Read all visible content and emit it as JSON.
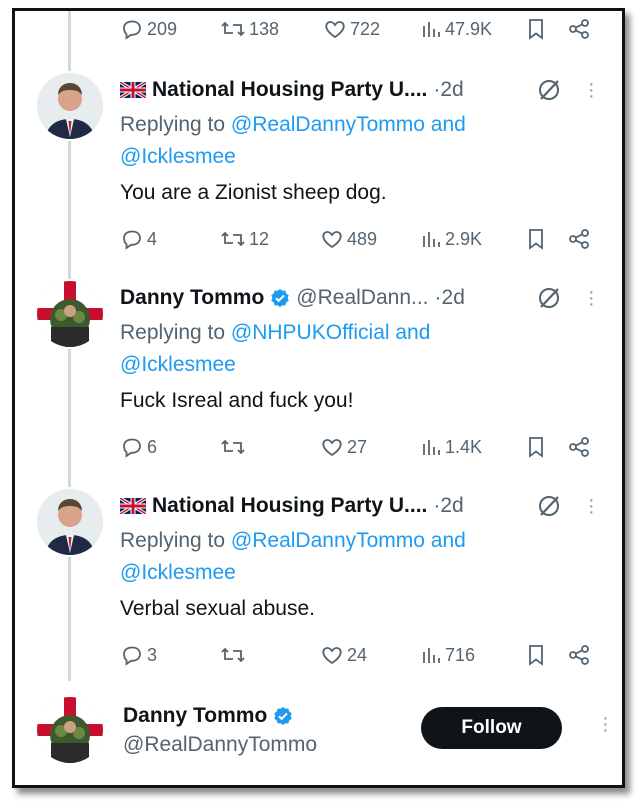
{
  "top_actions": {
    "replies": "209",
    "reposts": "138",
    "likes": "722",
    "views": "47.9K"
  },
  "tweets": [
    {
      "flag": "🇬🇧",
      "name": "National Housing Party U....",
      "handle": "",
      "dot": "·",
      "time": "2d",
      "reply_prefix": "Replying to ",
      "reply_mention_1": "@RealDannyTommo",
      "reply_and": " and",
      "reply_mention_2": "@Icklesmee",
      "text": "You are a Zionist sheep dog.",
      "replies": "4",
      "reposts": "12",
      "likes": "489",
      "views": "2.9K"
    },
    {
      "flag": "",
      "name": "Danny Tommo",
      "handle": "@RealDann...",
      "dot": "·",
      "time": "2d",
      "reply_prefix": "Replying to ",
      "reply_mention_1": "@NHPUKOfficial",
      "reply_and": " and",
      "reply_mention_2": "@Icklesmee",
      "text": "Fuck Isreal and fuck you!",
      "replies": "6",
      "reposts": "",
      "likes": "27",
      "views": "1.4K"
    },
    {
      "flag": "🇬🇧",
      "name": "National Housing Party U....",
      "handle": "",
      "dot": "·",
      "time": "2d",
      "reply_prefix": "Replying to ",
      "reply_mention_1": "@RealDannyTommo",
      "reply_and": " and",
      "reply_mention_2": "@Icklesmee",
      "text": "Verbal sexual abuse.",
      "replies": "3",
      "reposts": "",
      "likes": "24",
      "views": "716"
    }
  ],
  "profile": {
    "name": "Danny Tommo",
    "handle": "@RealDannyTommo",
    "follow_label": "Follow"
  },
  "colors": {
    "accent": "#1d9bf0",
    "text": "#0f1419",
    "secondary": "#536471"
  }
}
